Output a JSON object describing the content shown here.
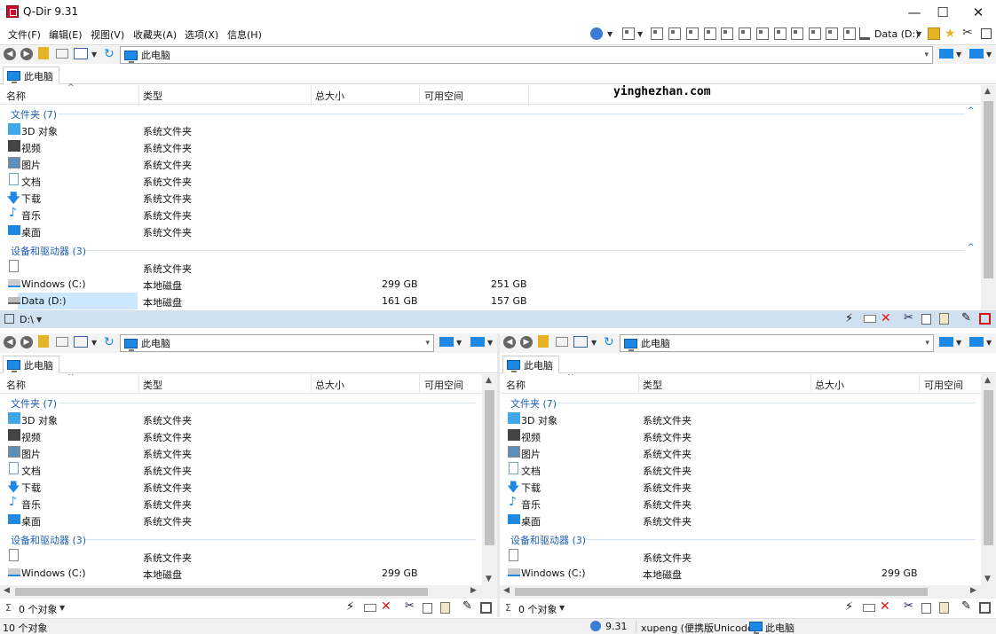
{
  "app": {
    "title": "Q-Dir 9.31",
    "controls": [
      "—",
      "☐",
      "✕"
    ]
  },
  "menu": [
    "文件(F)",
    "编辑(E)",
    "视图(V)",
    "收藏夹(A)",
    "选项(X)",
    "信息(H)"
  ],
  "toolbar": {
    "drive_label": "Data (D:)"
  },
  "watermark": "yinghezhan.com",
  "panes": {
    "top": {
      "address": "此电脑",
      "tab": "此电脑",
      "path_label": "D:\\",
      "columns": [
        "名称",
        "类型",
        "总大小",
        "可用空间"
      ],
      "group_folders": "文件夹 (7)",
      "group_drives": "设备和驱动器 (3)",
      "folders": [
        [
          "3D 对象",
          "系统文件夹"
        ],
        [
          "视频",
          "系统文件夹"
        ],
        [
          "图片",
          "系统文件夹"
        ],
        [
          "文档",
          "系统文件夹"
        ],
        [
          "下载",
          "系统文件夹"
        ],
        [
          "音乐",
          "系统文件夹"
        ],
        [
          "桌面",
          "系统文件夹"
        ]
      ],
      "drives": [
        [
          "",
          "系统文件夹",
          "",
          ""
        ],
        [
          "Windows (C:)",
          "本地磁盘",
          "299 GB",
          "251 GB"
        ],
        [
          "Data (D:)",
          "本地磁盘",
          "161 GB",
          "157 GB"
        ]
      ]
    },
    "left": {
      "address": "此电脑",
      "tab": "此电脑",
      "status": "0 个对象"
    },
    "right": {
      "address": "此电脑",
      "tab": "此电脑",
      "status": "0 个对象"
    }
  },
  "sub": {
    "columns": [
      "名称",
      "类型",
      "总大小",
      "可用空间"
    ],
    "group_folders": "文件夹 (7)",
    "group_drives": "设备和驱动器 (3)",
    "folders": [
      [
        "3D 对象",
        "系统文件夹"
      ],
      [
        "视频",
        "系统文件夹"
      ],
      [
        "图片",
        "系统文件夹"
      ],
      [
        "文档",
        "系统文件夹"
      ],
      [
        "下载",
        "系统文件夹"
      ],
      [
        "音乐",
        "系统文件夹"
      ],
      [
        "桌面",
        "系统文件夹"
      ]
    ],
    "drives": [
      [
        "",
        "系统文件夹",
        ""
      ],
      [
        "Windows (C:)",
        "本地磁盘",
        "299 GB"
      ]
    ]
  },
  "statusbar": {
    "count": "10 个对象",
    "version": "9.31",
    "user": "xupeng (便携版Unicode)",
    "location": "此电脑"
  },
  "colors": {
    "accent": "#1e88e5",
    "group": "#1e5eb5",
    "selection": "#cce8ff",
    "titlebar_icon": "#c8102e",
    "delete": "#d11"
  }
}
